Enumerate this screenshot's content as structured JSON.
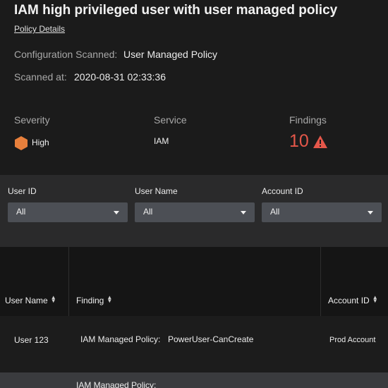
{
  "header": {
    "title": "IAM high privileged user with user managed policy",
    "policy_link": "Policy Details",
    "config_label": "Configuration Scanned:",
    "config_value": "User Managed Policy",
    "scanned_label": "Scanned at:",
    "scanned_value": "2020-08-31 02:33:36"
  },
  "summary": {
    "severity_label": "Severity",
    "severity_value": "High",
    "severity_color": "#e8803c",
    "service_label": "Service",
    "service_value": "IAM",
    "findings_label": "Findings",
    "findings_value": "10",
    "findings_color": "#e5574a",
    "findings_icon": "warning-icon"
  },
  "filters": {
    "user_id": {
      "label": "User ID",
      "value": "All"
    },
    "user_name": {
      "label": "User Name",
      "value": "All"
    },
    "account_id": {
      "label": "Account ID",
      "value": "All"
    }
  },
  "table": {
    "columns": [
      "User Name",
      "Finding",
      "Account ID"
    ],
    "rows": [
      {
        "user_name": "User 123",
        "finding_label": "IAM Managed Policy:",
        "finding_value": "PowerUser-CanCreate",
        "account_id": "Prod Account"
      },
      {
        "user_name": "",
        "finding_label": "IAM Managed Policy:",
        "finding_value": "",
        "account_id": ""
      }
    ]
  }
}
